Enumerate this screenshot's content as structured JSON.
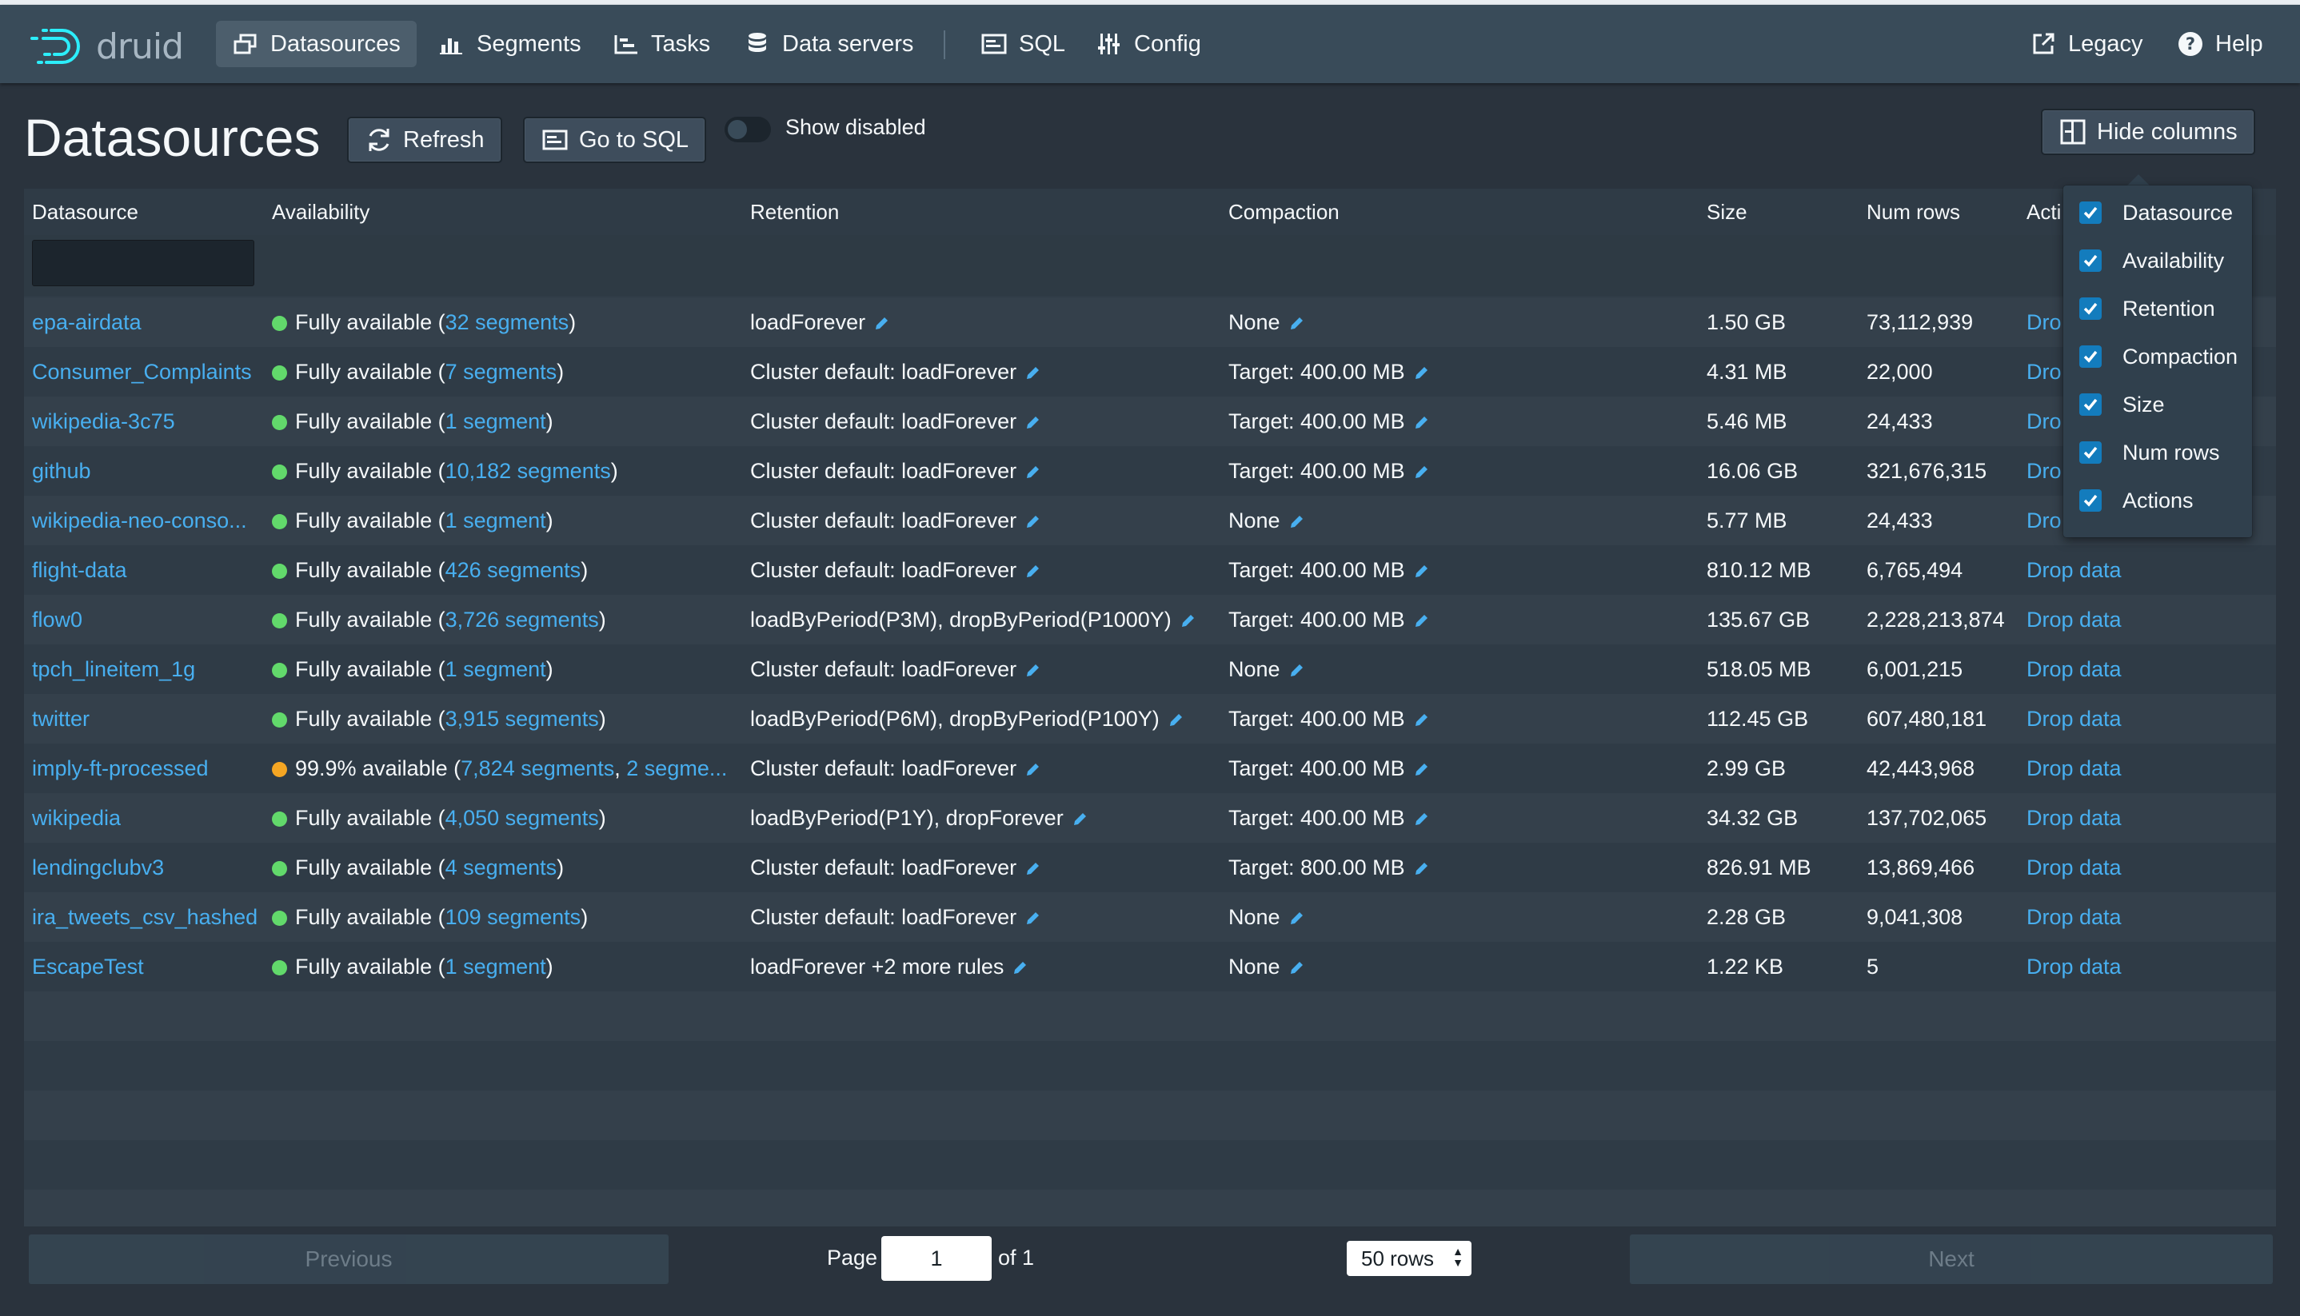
{
  "nav": {
    "logo_text": "druid",
    "items": [
      {
        "label": "Datasources",
        "icon": "datasources-icon",
        "active": true
      },
      {
        "label": "Segments",
        "icon": "segments-icon"
      },
      {
        "label": "Tasks",
        "icon": "tasks-icon"
      },
      {
        "label": "Data servers",
        "icon": "database-icon"
      },
      {
        "label": "SQL",
        "icon": "sql-console-icon"
      },
      {
        "label": "Config",
        "icon": "config-sliders-icon"
      }
    ],
    "legacy_label": "Legacy",
    "help_label": "Help"
  },
  "header": {
    "title": "Datasources",
    "refresh_label": "Refresh",
    "go_sql_label": "Go to SQL",
    "show_disabled_label": "Show disabled",
    "hide_columns_label": "Hide columns"
  },
  "table": {
    "columns": [
      "Datasource",
      "Availability",
      "Retention",
      "Compaction",
      "Size",
      "Num rows",
      "Acti"
    ],
    "rows": [
      {
        "name": "epa-airdata",
        "status": "green",
        "avail_prefix": "Fully available (",
        "avail_link": "32 segments",
        "avail_suffix": ")",
        "retention": "loadForever",
        "compaction": "None",
        "size": "1.50 GB",
        "num_rows": "73,112,939",
        "action": "Dro"
      },
      {
        "name": "Consumer_Complaints",
        "status": "green",
        "avail_prefix": "Fully available (",
        "avail_link": "7 segments",
        "avail_suffix": ")",
        "retention": "Cluster default: loadForever",
        "compaction": "Target: 400.00 MB",
        "size": "4.31 MB",
        "num_rows": "22,000",
        "action": "Dro"
      },
      {
        "name": "wikipedia-3c75",
        "status": "green",
        "avail_prefix": "Fully available (",
        "avail_link": "1 segment",
        "avail_suffix": ")",
        "retention": "Cluster default: loadForever",
        "compaction": "Target: 400.00 MB",
        "size": "5.46 MB",
        "num_rows": "24,433",
        "action": "Dro"
      },
      {
        "name": "github",
        "status": "green",
        "avail_prefix": "Fully available (",
        "avail_link": "10,182 segments",
        "avail_suffix": ")",
        "retention": "Cluster default: loadForever",
        "compaction": "Target: 400.00 MB",
        "size": "16.06 GB",
        "num_rows": "321,676,315",
        "action": "Dro"
      },
      {
        "name": "wikipedia-neo-conso...",
        "status": "green",
        "avail_prefix": "Fully available (",
        "avail_link": "1 segment",
        "avail_suffix": ")",
        "retention": "Cluster default: loadForever",
        "compaction": "None",
        "size": "5.77 MB",
        "num_rows": "24,433",
        "action": "Dro"
      },
      {
        "name": "flight-data",
        "status": "green",
        "avail_prefix": "Fully available (",
        "avail_link": "426 segments",
        "avail_suffix": ")",
        "retention": "Cluster default: loadForever",
        "compaction": "Target: 400.00 MB",
        "size": "810.12 MB",
        "num_rows": "6,765,494",
        "action": "Drop data"
      },
      {
        "name": "flow0",
        "status": "green",
        "avail_prefix": "Fully available (",
        "avail_link": "3,726 segments",
        "avail_suffix": ")",
        "retention": "loadByPeriod(P3M), dropByPeriod(P1000Y)",
        "compaction": "Target: 400.00 MB",
        "size": "135.67 GB",
        "num_rows": "2,228,213,874",
        "action": "Drop data"
      },
      {
        "name": "tpch_lineitem_1g",
        "status": "green",
        "avail_prefix": "Fully available (",
        "avail_link": "1 segment",
        "avail_suffix": ")",
        "retention": "Cluster default: loadForever",
        "compaction": "None",
        "size": "518.05 MB",
        "num_rows": "6,001,215",
        "action": "Drop data"
      },
      {
        "name": "twitter",
        "status": "green",
        "avail_prefix": "Fully available (",
        "avail_link": "3,915 segments",
        "avail_suffix": ")",
        "retention": "loadByPeriod(P6M), dropByPeriod(P100Y)",
        "compaction": "Target: 400.00 MB",
        "size": "112.45 GB",
        "num_rows": "607,480,181",
        "action": "Drop data"
      },
      {
        "name": "imply-ft-processed",
        "status": "orange",
        "avail_prefix": "99.9% available (",
        "avail_link": "7,824 segments",
        "avail_suffix": ", ",
        "avail_link2": "2 segme...",
        "retention": "Cluster default: loadForever",
        "compaction": "Target: 400.00 MB",
        "size": "2.99 GB",
        "num_rows": "42,443,968",
        "action": "Drop data"
      },
      {
        "name": "wikipedia",
        "status": "green",
        "avail_prefix": "Fully available (",
        "avail_link": "4,050 segments",
        "avail_suffix": ")",
        "retention": "loadByPeriod(P1Y), dropForever",
        "compaction": "Target: 400.00 MB",
        "size": "34.32 GB",
        "num_rows": "137,702,065",
        "action": "Drop data"
      },
      {
        "name": "lendingclubv3",
        "status": "green",
        "avail_prefix": "Fully available (",
        "avail_link": "4 segments",
        "avail_suffix": ")",
        "retention": "Cluster default: loadForever",
        "compaction": "Target: 800.00 MB",
        "size": "826.91 MB",
        "num_rows": "13,869,466",
        "action": "Drop data"
      },
      {
        "name": "ira_tweets_csv_hashed",
        "status": "green",
        "avail_prefix": "Fully available (",
        "avail_link": "109 segments",
        "avail_suffix": ")",
        "retention": "Cluster default: loadForever",
        "compaction": "None",
        "size": "2.28 GB",
        "num_rows": "9,041,308",
        "action": "Drop data"
      },
      {
        "name": "EscapeTest",
        "status": "green",
        "avail_prefix": "Fully available (",
        "avail_link": "1 segment",
        "avail_suffix": ")",
        "retention": "loadForever +2 more rules",
        "compaction": "None",
        "size": "1.22 KB",
        "num_rows": "5",
        "action": "Drop data"
      }
    ]
  },
  "pagination": {
    "previous_label": "Previous",
    "page_label": "Page",
    "page_value": "1",
    "of_label": "of 1",
    "rows_label": "50 rows",
    "next_label": "Next"
  },
  "column_menu": {
    "options": [
      "Datasource",
      "Availability",
      "Retention",
      "Compaction",
      "Size",
      "Num rows",
      "Actions"
    ]
  },
  "colors": {
    "green": "#62d96b",
    "orange": "#f5a623",
    "link": "#48aff0",
    "checkbox": "#137cbd"
  }
}
